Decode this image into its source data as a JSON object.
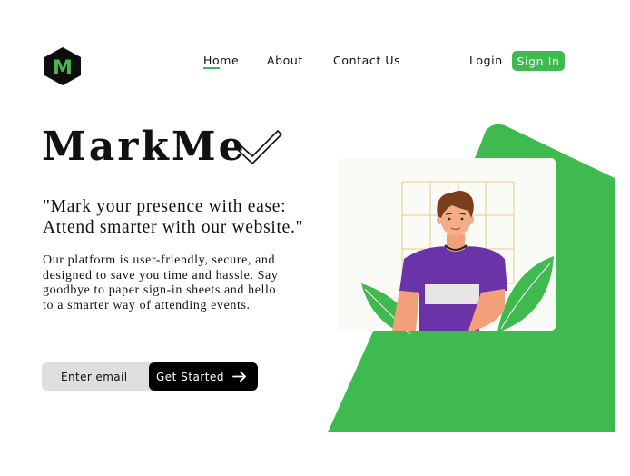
{
  "logo": {
    "letter": "M",
    "icon": "hexagon-logo-icon",
    "fg": "#3fba4f",
    "bg": "#0d0d0d"
  },
  "nav": {
    "items": [
      {
        "label": "Home",
        "active": true
      },
      {
        "label": "About",
        "active": false
      },
      {
        "label": "Contact Us",
        "active": false
      }
    ],
    "login_label": "Login",
    "signin_label": "Sign In"
  },
  "hero": {
    "title": "MarkMe",
    "tagline_line1": "\"Mark your presence with ease:",
    "tagline_line2": "Attend smarter with our website.\"",
    "description_lines": [
      "Our platform is user-friendly, secure, and",
      "designed to save you time and hassle. Say",
      "goodbye to paper sign-in sheets and hello",
      "to a smarter way of attending events."
    ],
    "email_placeholder": "Enter email",
    "cta_label": "Get Started",
    "cta_icon": "arrow-right-icon",
    "illustration": "person-with-grid-illustration"
  },
  "colors": {
    "accent": "#3fba4f",
    "text": "#111111",
    "button_dark": "#000000",
    "input_bg": "#dedede"
  }
}
